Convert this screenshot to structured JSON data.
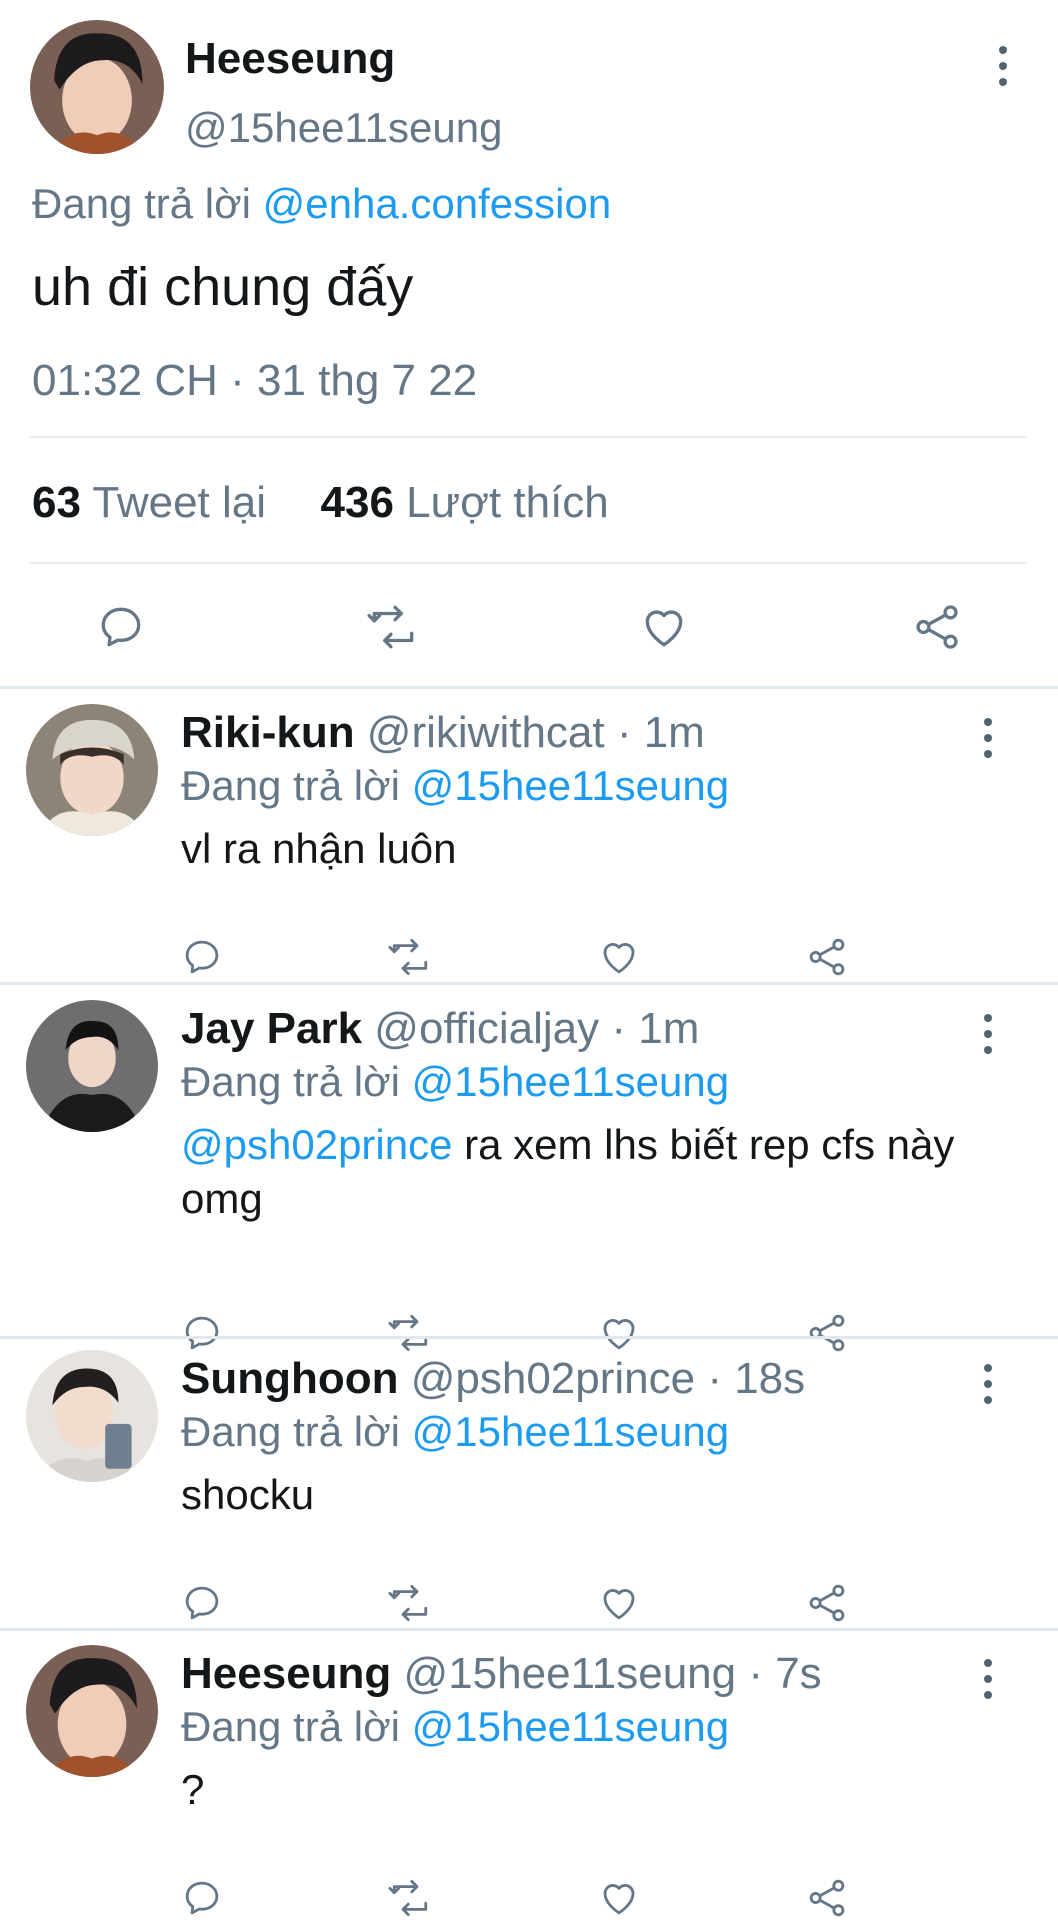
{
  "main_tweet": {
    "name": "Heeseung",
    "handle": "@15hee11seung",
    "replying_prefix": "Đang trả lời ",
    "replying_to": "@enha.confession",
    "text": "uh đi chung đấy",
    "timestamp": "01:32 CH · 31 thg 7 22",
    "retweets_count": "63",
    "retweets_label": " Tweet lại",
    "likes_count": "436",
    "likes_label": " Lượt thích"
  },
  "replies": [
    {
      "name": "Riki-kun",
      "rest": " @rikiwithcat · 1m",
      "replying_prefix": "Đang trả lời ",
      "replying_to": "@15hee11seung",
      "mention": "",
      "text": "vl ra nhận luôn"
    },
    {
      "name": "Jay Park",
      "rest": " @officialjay · 1m",
      "replying_prefix": "Đang trả lời ",
      "replying_to": "@15hee11seung",
      "mention": "@psh02prince",
      "text": " ra xem lhs biết rep cfs này omg"
    },
    {
      "name": "Sunghoon",
      "rest": " @psh02prince · 18s",
      "replying_prefix": "Đang trả lời ",
      "replying_to": "@15hee11seung",
      "mention": "",
      "text": "shocku"
    },
    {
      "name": "Heeseung",
      "rest": " @15hee11seung · 7s",
      "replying_prefix": "Đang trả lời ",
      "replying_to": "@15hee11seung",
      "mention": "",
      "text": "?"
    }
  ],
  "icons": {
    "reply": "reply-icon",
    "retweet": "retweet-icon",
    "like": "heart-icon",
    "share": "share-icon",
    "more": "more-icon"
  },
  "colors": {
    "link": "#1d9bf0",
    "secondary_text": "#657786",
    "primary_text": "#14171a"
  }
}
